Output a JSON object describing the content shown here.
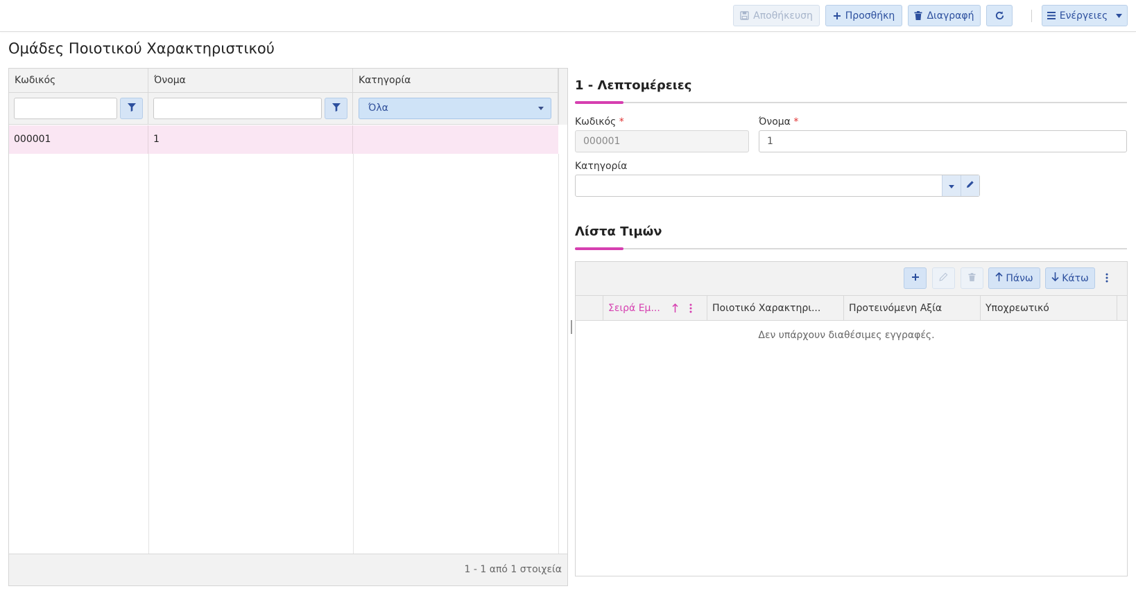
{
  "toolbar": {
    "save_label": "Αποθήκευση",
    "add_label": "Προσθήκη",
    "delete_label": "Διαγραφή",
    "actions_label": "Ενέργειες"
  },
  "page": {
    "title": "Ομάδες Ποιοτικού Χαρακτηριστικού"
  },
  "grid": {
    "columns": [
      "Κωδικός",
      "Όνομα",
      "Κατηγορία"
    ],
    "category_filter_value": "Όλα",
    "rows": [
      {
        "code": "000001",
        "name": "1",
        "category": ""
      }
    ],
    "pager_text": "1 - 1 από 1 στοιχεία"
  },
  "details": {
    "section_title": "1 - Λεπτομέρειες",
    "code_label": "Κωδικός",
    "code_value": "000001",
    "name_label": "Όνομα",
    "name_value": "1",
    "category_label": "Κατηγορία",
    "category_value": "",
    "required_mark": "*"
  },
  "values_list": {
    "section_title": "Λίστα Τιμών",
    "up_label": "Πάνω",
    "down_label": "Κάτω",
    "columns": [
      "Σειρά Εμ...",
      "Ποιοτικό Χαρακτηρι...",
      "Προτεινόμενη Αξία",
      "Υποχρεωτικό"
    ],
    "empty_message": "Δεν υπάρχουν διαθέσιμες εγγραφές."
  },
  "colors": {
    "accent": "#d63fb0",
    "button_bg": "#d5e4f6",
    "button_text": "#2c4f9e",
    "selected_row": "#fae6f3"
  }
}
